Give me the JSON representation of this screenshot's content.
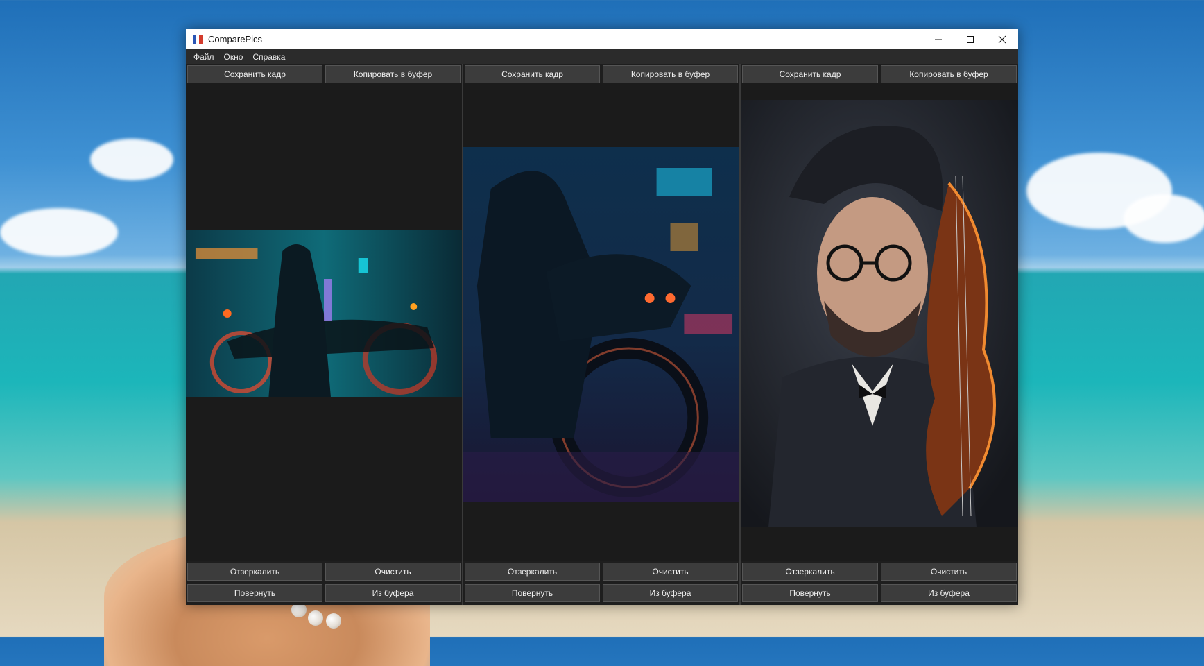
{
  "window": {
    "title": "ComparePics"
  },
  "menu": [
    "Файл",
    "Окно",
    "Справка"
  ],
  "panels": [
    {
      "save": "Сохранить кадр",
      "copy": "Копировать в буфер",
      "mirror": "Отзеркалить",
      "clear": "Очистить",
      "rotate": "Повернуть",
      "paste": "Из буфера"
    },
    {
      "save": "Сохранить кадр",
      "copy": "Копировать в буфер",
      "mirror": "Отзеркалить",
      "clear": "Очистить",
      "rotate": "Повернуть",
      "paste": "Из буфера"
    },
    {
      "save": "Сохранить кадр",
      "copy": "Копировать в буфер",
      "mirror": "Отзеркалить",
      "clear": "Очистить",
      "rotate": "Повернуть",
      "paste": "Из буфера"
    }
  ],
  "colors": {
    "window_bg": "#1e1e1e",
    "button_bg": "#3c3c3c",
    "menubar_bg": "#2b2b2b"
  }
}
